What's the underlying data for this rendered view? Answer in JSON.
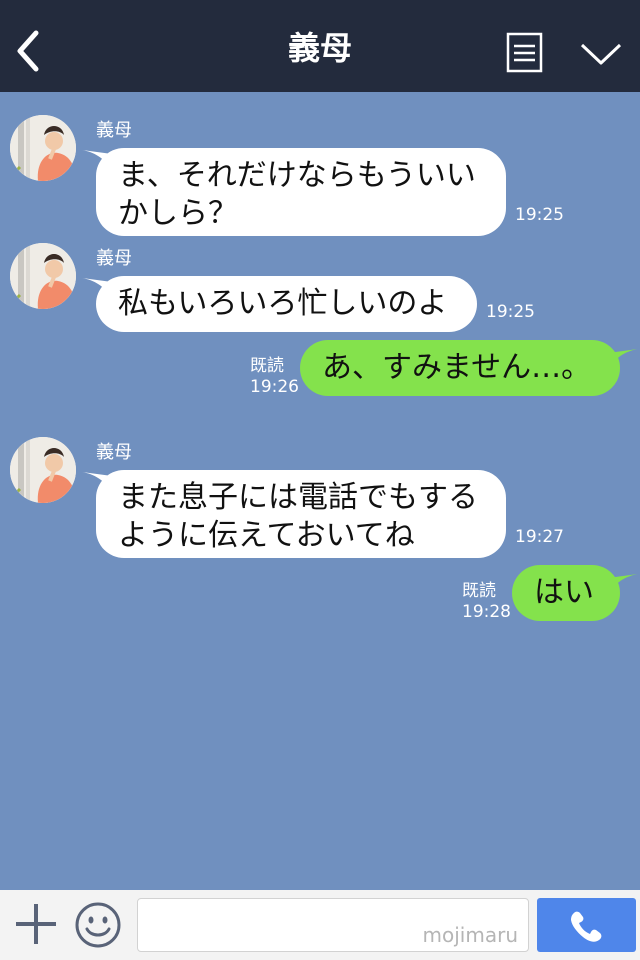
{
  "header": {
    "title": "義母",
    "back_icon": "chevron-left-icon",
    "notes_icon": "notes-icon",
    "menu_icon": "chevron-down-icon"
  },
  "messages": [
    {
      "sender": "義母",
      "lines": [
        "ま、それだけならもういい",
        "かしら？"
      ],
      "time": "19:25"
    },
    {
      "sender": "義母",
      "lines": [
        "私もいろいろ忙しいのよ"
      ],
      "time": "19:25"
    },
    {
      "read": "既読",
      "lines": [
        "あ、すみません…。"
      ],
      "time": "19:26"
    },
    {
      "sender": "義母",
      "lines": [
        "また息子には電話でもする",
        "ように伝えておいてね"
      ],
      "time": "19:27"
    },
    {
      "read": "既読",
      "lines": [
        "はい"
      ],
      "time": "19:28"
    }
  ],
  "footer": {
    "input_value": "",
    "watermark": "mojimaru",
    "plus_icon": "plus-icon",
    "emoji_icon": "emoji-icon",
    "call_icon": "phone-icon"
  },
  "colors": {
    "chat_background": "#7090bf",
    "header_background": "#232b3d",
    "incoming_bubble": "#ffffff",
    "outgoing_bubble": "#84e24c",
    "call_button": "#4f86ea"
  }
}
